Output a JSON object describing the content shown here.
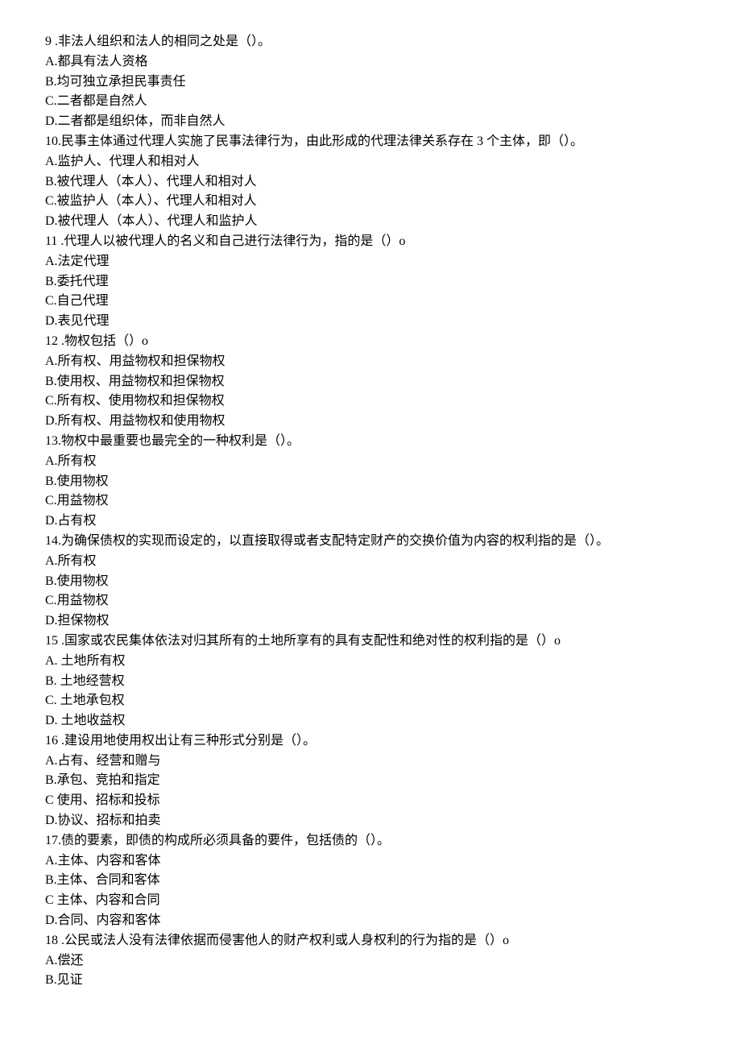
{
  "questions": [
    {
      "id": 9,
      "stem": "9 .非法人组织和法人的相同之处是（）。",
      "options": [
        "A.都具有法人资格",
        "B.均可独立承担民事责任",
        "C.二者都是自然人",
        "D.二者都是组织体，而非自然人"
      ]
    },
    {
      "id": 10,
      "stem": "10.民事主体通过代理人实施了民事法律行为，由此形成的代理法律关系存在 3 个主体，即（）。",
      "options": [
        "A.监护人、代理人和相对人",
        "B.被代理人（本人）、代理人和相对人",
        "C.被监护人（本人）、代理人和相对人",
        "D.被代理人（本人）、代理人和监护人"
      ]
    },
    {
      "id": 11,
      "stem": "11 .代理人以被代理人的名义和自己进行法律行为，指的是（）o",
      "options": [
        "A.法定代理",
        "B.委托代理",
        "C.自己代理",
        "D.表见代理"
      ]
    },
    {
      "id": 12,
      "stem": "12 .物权包括（）o",
      "options": [
        "A.所有权、用益物权和担保物权",
        "B.使用权、用益物权和担保物权",
        "C.所有权、使用物权和担保物权",
        "D.所有权、用益物权和使用物权"
      ]
    },
    {
      "id": 13,
      "stem": "13.物权中最重要也最完全的一种权利是（）。",
      "options": [
        "A.所有权",
        "B.使用物权",
        "C.用益物权",
        "D.占有权"
      ]
    },
    {
      "id": 14,
      "stem": "14.为确保债权的实现而设定的，以直接取得或者支配特定财产的交换价值为内容的权利指的是（）。",
      "options": [
        "A.所有权",
        "B.使用物权",
        "C.用益物权",
        "D.担保物权"
      ]
    },
    {
      "id": 15,
      "stem": "15 .国家或农民集体依法对归其所有的土地所享有的具有支配性和绝对性的权利指的是（）o",
      "options": [
        "A. 土地所有权",
        "B. 土地经营权",
        "C. 土地承包权",
        "D. 土地收益权"
      ]
    },
    {
      "id": 16,
      "stem": "16 .建设用地使用权出让有三种形式分别是（）。",
      "options": [
        "A.占有、经营和赠与",
        "B.承包、竞拍和指定",
        "C 使用、招标和投标",
        "D.协议、招标和拍卖"
      ]
    },
    {
      "id": 17,
      "stem": "17.债的要素，即债的构成所必须具备的要件，包括债的（）。",
      "options": [
        "A.主体、内容和客体",
        "B.主体、合同和客体",
        "C 主体、内容和合同",
        "D.合同、内容和客体"
      ]
    },
    {
      "id": 18,
      "stem": "18 .公民或法人没有法律依据而侵害他人的财产权利或人身权利的行为指的是（）o",
      "options": [
        "A.偿还",
        "B.见证"
      ]
    }
  ]
}
